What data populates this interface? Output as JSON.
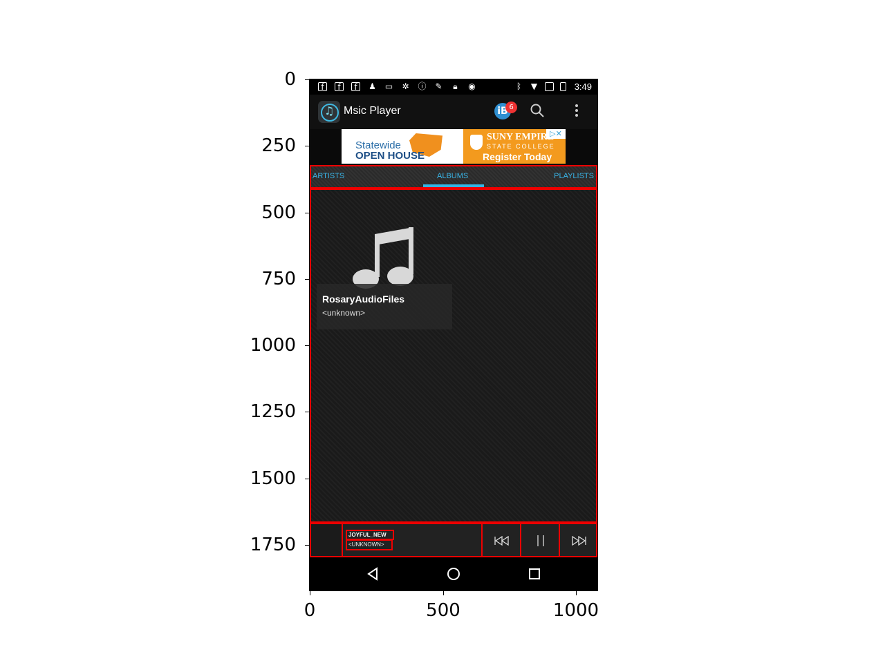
{
  "axes": {
    "y_ticks": [
      "0",
      "250",
      "500",
      "750",
      "1000",
      "1250",
      "1500",
      "1750"
    ],
    "x_ticks": [
      "0",
      "500",
      "1000"
    ]
  },
  "status_bar": {
    "time": "3:49",
    "left_icons": [
      "facebook-icon",
      "facebook-icon",
      "facebook-icon",
      "person-icon",
      "cast-icon",
      "brightness-icon",
      "alert-icon",
      "no-wifi-icon",
      "lock-icon",
      "android-icon"
    ],
    "right_icons": [
      "bluetooth-icon",
      "wifi-icon",
      "no-signal-icon",
      "battery-icon"
    ]
  },
  "action_bar": {
    "title": "Msic Player",
    "badge_label": "iB",
    "badge_count": "6",
    "icons": [
      "app-icon",
      "ibotta-icon",
      "search-icon",
      "overflow-menu-icon"
    ]
  },
  "ad": {
    "line1": "Statewide",
    "line2": "OPEN HOUSE",
    "brand": "SUNY EMPIRE",
    "brand_sub": "STATE COLLEGE",
    "cta": "Register Today",
    "close": "▷✕"
  },
  "tabs": [
    {
      "label": "ARTISTS",
      "selected": false
    },
    {
      "label": "ALBUMS",
      "selected": true
    },
    {
      "label": "PLAYLISTS",
      "selected": false
    }
  ],
  "albums": [
    {
      "title": "RosaryAudioFiles",
      "artist": "<unknown>",
      "icon": "music-note-icon"
    }
  ],
  "now_playing": {
    "title": "JOYFUL_NEW",
    "artist": "<UNKNOWN>",
    "controls": [
      "previous-icon",
      "pause-icon",
      "next-icon"
    ]
  },
  "nav_bar": {
    "buttons": [
      "back-icon",
      "home-icon",
      "recents-icon"
    ]
  },
  "colors": {
    "accent": "#33b5e5",
    "annotation": "#e00000",
    "background": "#000000"
  }
}
